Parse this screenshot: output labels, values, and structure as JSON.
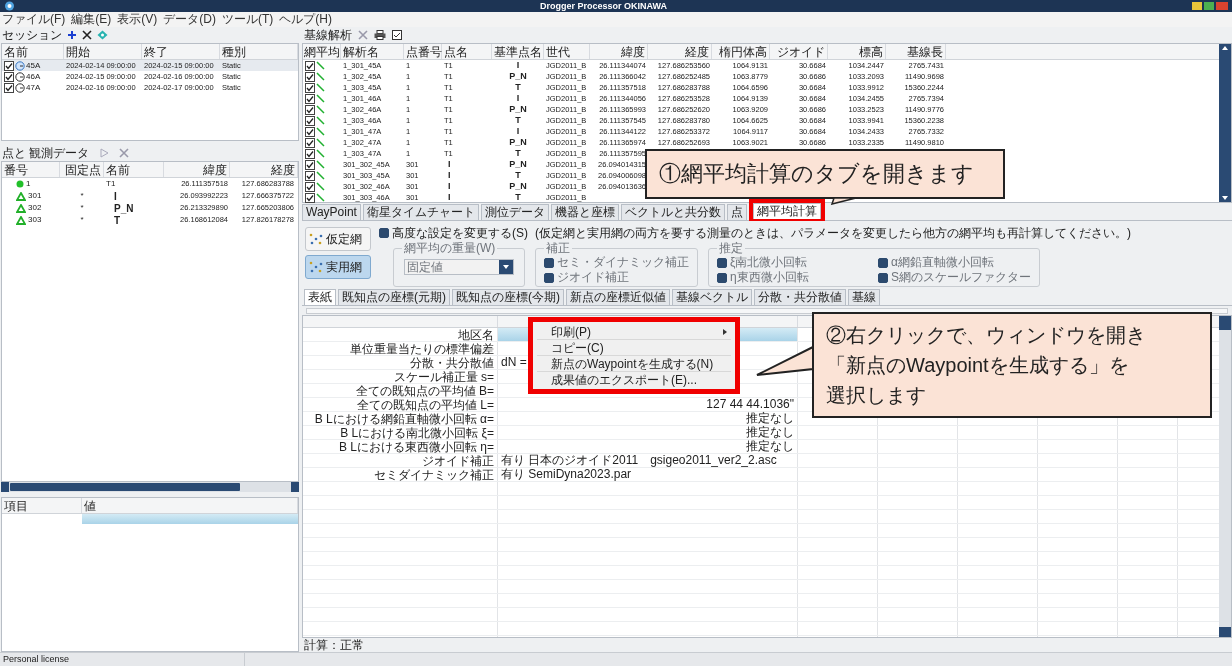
{
  "window": {
    "title": "Drogger Processor OKINAWA"
  },
  "menu": [
    "ファイル(F)",
    "編集(E)",
    "表示(V)",
    "データ(D)",
    "ツール(T)",
    "ヘルプ(H)"
  ],
  "sessions": {
    "title": "セッション",
    "columns": [
      "名前",
      "開始",
      "終了",
      "種別"
    ],
    "rows": [
      {
        "checked": true,
        "selected": true,
        "cells": [
          "45A",
          "2024-02-14 09:00:00",
          "2024-02-15 09:00:00",
          "Static"
        ]
      },
      {
        "checked": true,
        "selected": false,
        "cells": [
          "46A",
          "2024-02-15 09:00:00",
          "2024-02-16 09:00:00",
          "Static"
        ]
      },
      {
        "checked": true,
        "selected": false,
        "cells": [
          "47A",
          "2024-02-16 09:00:00",
          "2024-02-17 09:00:00",
          "Static"
        ]
      }
    ]
  },
  "points": {
    "title": "点と 観測データ",
    "columns": [
      "番号",
      "固定点",
      "名前",
      "緯度",
      "経度"
    ],
    "rows": [
      {
        "kind": "fixed",
        "number": "1",
        "name": "T1",
        "lat": "26.111357518",
        "lon": "127.686283788"
      },
      {
        "kind": "known",
        "number": "301",
        "fixed": "*",
        "name": "I",
        "lat": "26.093992223",
        "lon": "127.666375722"
      },
      {
        "kind": "known",
        "number": "302",
        "fixed": "*",
        "name": "P_N",
        "lat": "26.213329890",
        "lon": "127.665203806"
      },
      {
        "kind": "known",
        "number": "303",
        "fixed": "*",
        "name": "T",
        "lat": "26.168612084",
        "lon": "127.826178278"
      }
    ]
  },
  "properties": {
    "columns": [
      "項目",
      "値"
    ]
  },
  "baselines": {
    "title": "基線解析",
    "check_column": "網平均",
    "columns": [
      "解析名",
      "点番号",
      "点名",
      "基準点名",
      "世代",
      "緯度",
      "経度",
      "楕円体高",
      "ジオイド",
      "標高",
      "基線長"
    ],
    "rows": [
      {
        "checked": true,
        "cells": [
          "1_301_45A",
          "1",
          "T1",
          "I",
          "JGD2011_B",
          "26.111344074",
          "127.686253560",
          "1064.9131",
          "30.6684",
          "1034.2447",
          "2765.7431"
        ]
      },
      {
        "checked": true,
        "cells": [
          "1_302_45A",
          "1",
          "T1",
          "P_N",
          "JGD2011_B",
          "26.111366042",
          "127.686252485",
          "1063.8779",
          "30.6686",
          "1033.2093",
          "11490.9698"
        ]
      },
      {
        "checked": true,
        "cells": [
          "1_303_45A",
          "1",
          "T1",
          "T",
          "JGD2011_B",
          "26.111357518",
          "127.686283788",
          "1064.6596",
          "30.6684",
          "1033.9912",
          "15360.2244"
        ]
      },
      {
        "checked": true,
        "cells": [
          "1_301_46A",
          "1",
          "T1",
          "I",
          "JGD2011_B",
          "26.111344056",
          "127.686253528",
          "1064.9139",
          "30.6684",
          "1034.2455",
          "2765.7394"
        ]
      },
      {
        "checked": true,
        "cells": [
          "1_302_46A",
          "1",
          "T1",
          "P_N",
          "JGD2011_B",
          "26.111365993",
          "127.686252620",
          "1063.9209",
          "30.6686",
          "1033.2523",
          "11490.9776"
        ]
      },
      {
        "checked": true,
        "cells": [
          "1_303_46A",
          "1",
          "T1",
          "T",
          "JGD2011_B",
          "26.111357545",
          "127.686283780",
          "1064.6625",
          "30.6684",
          "1033.9941",
          "15360.2238"
        ]
      },
      {
        "checked": true,
        "cells": [
          "1_301_47A",
          "1",
          "T1",
          "I",
          "JGD2011_B",
          "26.111344122",
          "127.686253372",
          "1064.9117",
          "30.6684",
          "1034.2433",
          "2765.7332"
        ]
      },
      {
        "checked": true,
        "cells": [
          "1_302_47A",
          "1",
          "T1",
          "P_N",
          "JGD2011_B",
          "26.111365974",
          "127.686252693",
          "1063.9021",
          "30.6686",
          "1033.2335",
          "11490.9810"
        ]
      },
      {
        "checked": true,
        "cells": [
          "1_303_47A",
          "1",
          "T1",
          "T",
          "JGD2011_B",
          "26.111357595"
        ]
      },
      {
        "checked": true,
        "cells": [
          "301_302_45A",
          "301",
          "I",
          "P_N",
          "JGD2011_B",
          "26.094014315"
        ]
      },
      {
        "checked": true,
        "cells": [
          "301_303_45A",
          "301",
          "I",
          "T",
          "JGD2011_B",
          "26.094006098"
        ]
      },
      {
        "checked": true,
        "cells": [
          "301_302_46A",
          "301",
          "I",
          "P_N",
          "JGD2011_B",
          "26.094013636"
        ]
      },
      {
        "checked": true,
        "cells": [
          "301_303_46A",
          "301",
          "I",
          "T",
          "JGD2011_B"
        ]
      }
    ]
  },
  "tabs": [
    {
      "label": "WayPoint",
      "selected": false
    },
    {
      "label": "衛星タイムチャート",
      "selected": false
    },
    {
      "label": "測位データ",
      "selected": false
    },
    {
      "label": "機器と座標",
      "selected": false
    },
    {
      "label": "ベクトルと共分数",
      "selected": false
    },
    {
      "label": "点",
      "selected": false
    },
    {
      "label": "網平均計算",
      "selected": true
    }
  ],
  "settings": {
    "advanced": {
      "label": "高度な設定を変更する(S)",
      "checked": true
    },
    "note": "(仮定網と実用網の両方を要する測量のときは、パラメータを変更したら他方の網平均も再計算してください。)",
    "networks": [
      {
        "label": "仮定網",
        "selected": false
      },
      {
        "label": "実用網",
        "selected": true
      }
    ],
    "weight": {
      "legend": "網平均の重量(W)",
      "value": "固定値",
      "disabled": true
    },
    "correction": {
      "legend": "補正",
      "disabled": true,
      "options": [
        {
          "label": "セミ・ダイナミック補正",
          "checked": true
        },
        {
          "label": "ジオイド補正",
          "checked": true
        }
      ]
    },
    "estimation": {
      "legend": "推定",
      "disabled": true,
      "options": [
        {
          "label": "ξ南北微小回転",
          "checked": true
        },
        {
          "label": "α網鉛直軸微小回転",
          "checked": true
        },
        {
          "label": "η東西微小回転",
          "checked": true
        },
        {
          "label": "S網のスケールファクター",
          "checked": true
        }
      ]
    }
  },
  "report_tabs": [
    {
      "label": "表紙",
      "selected": true
    },
    {
      "label": "既知点の座標(元期)",
      "selected": false
    },
    {
      "label": "既知点の座標(今期)",
      "selected": false
    },
    {
      "label": "新点の座標近似値",
      "selected": false
    },
    {
      "label": "基線ベクトル",
      "selected": false
    },
    {
      "label": "分散・共分散値",
      "selected": false
    },
    {
      "label": "基線",
      "selected": false
    }
  ],
  "report": {
    "rows": [
      {
        "label": "地区名",
        "selected": true
      },
      {
        "label": "単位重量当たりの標準偏差",
        "selected": false
      },
      {
        "label": "分散・共分散値",
        "value": "dN =",
        "selected": false
      },
      {
        "label": "スケール補正量 s=",
        "selected": false
      },
      {
        "label": "全ての既知点の平均値 B=",
        "selected": false
      },
      {
        "label": "全ての既知点の平均値 L=",
        "result": "127 44 44.1036\"",
        "selected": false
      },
      {
        "label": "B Lにおける網鉛直軸微小回転 α=",
        "result": "推定なし",
        "selected": false
      },
      {
        "label": "B Lにおける南北微小回転 ξ=",
        "result": "推定なし",
        "selected": false
      },
      {
        "label": "B Lにおける東西微小回転 η=",
        "result": "推定なし",
        "selected": false
      },
      {
        "label": "ジオイド補正",
        "value": "有り 日本のジオイド2011　gsigeo2011_ver2_2.asc",
        "selected": false
      },
      {
        "label": "セミダイナミック補正",
        "value": "有り SemiDyna2023.par",
        "selected": false
      }
    ],
    "status": "計算：正常"
  },
  "context_menu": [
    {
      "label": "印刷(P)",
      "submenu": true
    },
    {
      "label": "コピー(C)",
      "submenu": false
    },
    {
      "label": "新点のWaypointを生成する(N)",
      "submenu": false
    },
    {
      "label": "成果値のエクスポート(E)...",
      "submenu": false
    }
  ],
  "callouts": [
    {
      "lines": [
        "①網平均計算のタブを開きます"
      ]
    },
    {
      "lines": [
        "②右クリックで、ウィンドウを開き",
        "「新点のWaypointを生成する」を",
        "選択します"
      ]
    }
  ],
  "status_bar": "Personal license"
}
